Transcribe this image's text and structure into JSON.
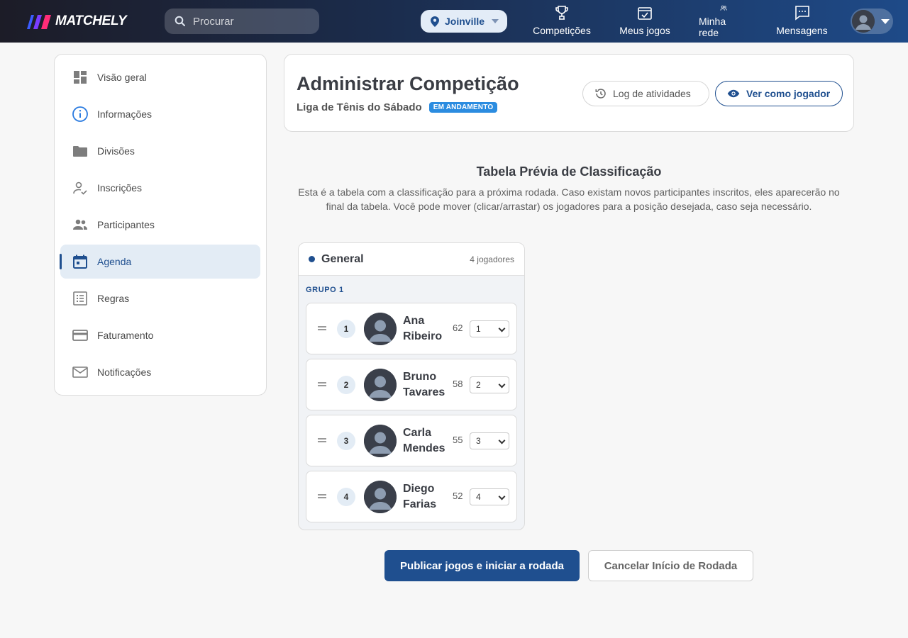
{
  "header": {
    "logo_text": "MATCHELY",
    "search": {
      "placeholder": "Procurar",
      "value": ""
    },
    "city": "Joinville",
    "nav": [
      {
        "label": "Competições",
        "icon": "trophy-icon"
      },
      {
        "label": "Meus jogos",
        "icon": "calendar-check-icon"
      },
      {
        "label": "Minha rede",
        "icon": "people-icon"
      },
      {
        "label": "Mensagens",
        "icon": "message-icon"
      }
    ]
  },
  "sidebar": {
    "items": [
      {
        "label": "Visão geral",
        "icon": "dashboard-icon"
      },
      {
        "label": "Informações",
        "icon": "info-icon"
      },
      {
        "label": "Divisões",
        "icon": "folder-icon"
      },
      {
        "label": "Inscrições",
        "icon": "person-check-icon"
      },
      {
        "label": "Participantes",
        "icon": "people-icon"
      },
      {
        "label": "Agenda",
        "icon": "calendar-icon",
        "active": true
      },
      {
        "label": "Regras",
        "icon": "list-icon"
      },
      {
        "label": "Faturamento",
        "icon": "credit-card-icon"
      },
      {
        "label": "Notificações",
        "icon": "mail-icon"
      }
    ]
  },
  "page": {
    "title": "Administrar Competição",
    "competition": "Liga de Tênis do Sábado",
    "status": "EM ANDAMENTO",
    "log_button": "Log de atividades",
    "view_button": "Ver como jogador"
  },
  "preview": {
    "title": "Tabela Prévia de Classificação",
    "description": "Esta é a tabela com a classificação para a próxima rodada. Caso existam novos participantes inscritos, eles aparecerão no final da tabela. Você pode mover (clicar/arrastar) os jogadores para a posição desejada, caso seja necessário.",
    "division": {
      "name": "General",
      "count": "4 jogadores",
      "group": "GRUPO 1",
      "players": [
        {
          "rank": "1",
          "name": "Ana Ribeiro",
          "points": "62",
          "position": "1"
        },
        {
          "rank": "2",
          "name": "Bruno Tavares",
          "points": "58",
          "position": "2"
        },
        {
          "rank": "3",
          "name": "Carla Mendes",
          "points": "55",
          "position": "3"
        },
        {
          "rank": "4",
          "name": "Diego Farias",
          "points": "52",
          "position": "4"
        }
      ]
    }
  },
  "actions": {
    "publish": "Publicar jogos e iniciar a rodada",
    "cancel": "Cancelar Início de Rodada"
  },
  "colors": {
    "accent": "#1f4f8f",
    "badge": "#2b8ce0",
    "active_bg": "#e3ecf5"
  }
}
